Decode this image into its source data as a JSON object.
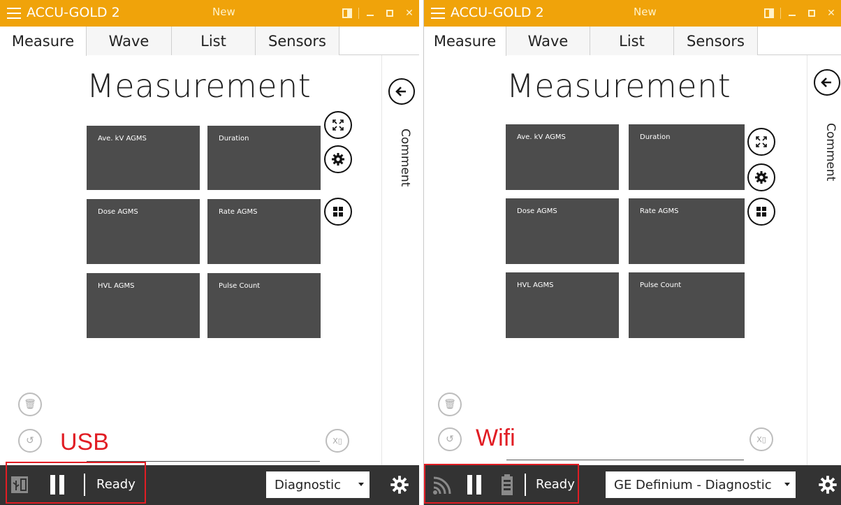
{
  "app": {
    "title": "ACCU-GOLD 2",
    "document_title": "New"
  },
  "tabs": [
    {
      "label": "Measure",
      "active": true
    },
    {
      "label": "Wave",
      "active": false
    },
    {
      "label": "List",
      "active": false
    },
    {
      "label": "Sensors",
      "active": false
    }
  ],
  "main": {
    "heading": "Measurement",
    "tiles": [
      {
        "label": "Ave. kV AGMS"
      },
      {
        "label": "Duration"
      },
      {
        "label": "Dose AGMS"
      },
      {
        "label": "Rate AGMS"
      },
      {
        "label": "HVL AGMS"
      },
      {
        "label": "Pulse Count"
      }
    ]
  },
  "sidebar": {
    "comment_label": "Comment"
  },
  "panels": [
    {
      "annotation": "USB",
      "connection_icon": "usb-icon",
      "status": "Ready",
      "mode_dropdown": "Diagnostic"
    },
    {
      "annotation": "Wifi",
      "connection_icon": "wifi-icon",
      "status": "Ready",
      "mode_dropdown": "GE Definium - Diagnostic"
    }
  ],
  "colors": {
    "titlebar": "#f0a30a",
    "tile": "#4c4c4c",
    "statusbar": "#333333",
    "annotation": "#e11d24"
  }
}
